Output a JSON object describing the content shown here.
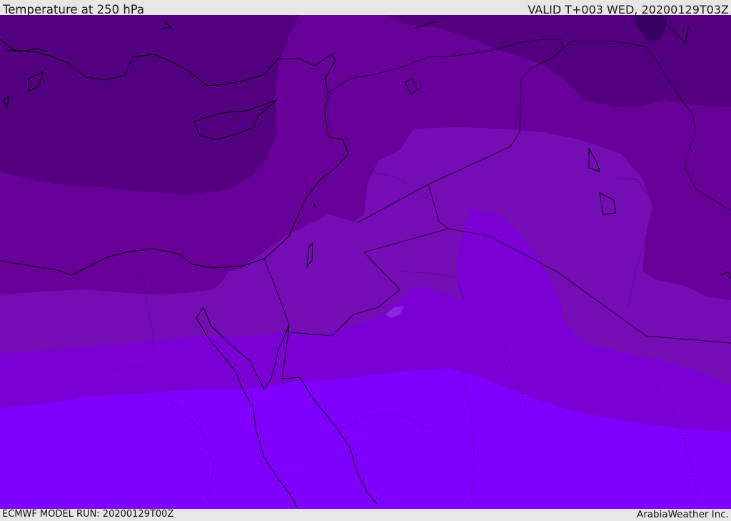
{
  "header": {
    "title": "Temperature at 250 hPa",
    "valid": "VALID T+003 WED, 20200129T03Z"
  },
  "footer": {
    "model_run": "ECMWF MODEL RUN: 20200129T00Z",
    "credit": "ArabiaWeather Inc."
  },
  "map": {
    "colors": {
      "band_darkest": "#3a0066",
      "band_1": "#52007f",
      "band_2": "#660099",
      "band_3": "#740eb4",
      "band_4": "#7a00d6",
      "band_5": "#8000ff",
      "coastline": "#000000",
      "border": "#1a0033"
    }
  }
}
